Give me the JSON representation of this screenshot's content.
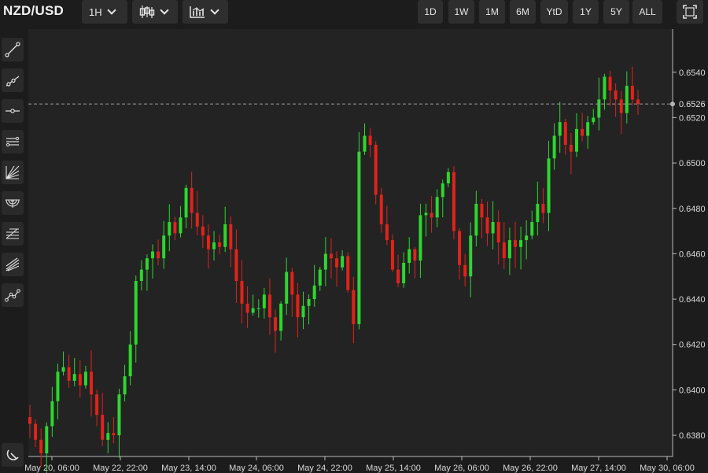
{
  "symbol": "NZD/USD",
  "interval": {
    "label": "1H"
  },
  "ranges": [
    "1D",
    "1W",
    "1M",
    "6M",
    "YtD",
    "1Y",
    "5Y",
    "ALL"
  ],
  "icons": {
    "chart_type": "candlestick-icon",
    "indicators": "bar-chart-icon",
    "fullscreen": "fullscreen-icon",
    "tools": [
      "trendline-icon",
      "ray-icon",
      "horizontal-line-icon",
      "channel-icon",
      "gann-fan-icon",
      "fib-arc-icon",
      "fib-retracement-icon",
      "pitchfork-icon",
      "path-icon",
      "magnet-icon"
    ]
  },
  "colors": {
    "up": "#2ed62e",
    "down": "#e0231a",
    "background": "#232323"
  },
  "chart_data": {
    "type": "candlestick",
    "title": "",
    "xlabel": "",
    "ylabel": "",
    "x_tick_labels": [
      "May 20, 06:00",
      "May 22, 22:00",
      "May 23, 14:00",
      "May 24, 06:00",
      "May 24, 22:00",
      "May 25, 14:00",
      "May 26, 06:00",
      "May 26, 22:00",
      "May 27, 14:00",
      "May 30, 06:00"
    ],
    "y_ticks": [
      0.638,
      0.64,
      0.642,
      0.644,
      0.646,
      0.648,
      0.65,
      0.652,
      0.654
    ],
    "y_tick_labels": [
      "0.6380",
      "0.6400",
      "0.6420",
      "0.6440",
      "0.6460",
      "0.6480",
      "0.6500",
      "0.6520",
      "0.6540"
    ],
    "ylim": [
      0.6371,
      0.6559
    ],
    "last_price": 0.6526,
    "last_price_label": "0.6526",
    "grid": false,
    "close_path": [
      0.6385,
      0.6378,
      0.6372,
      0.6384,
      0.6395,
      0.6408,
      0.641,
      0.6404,
      0.6407,
      0.6402,
      0.6408,
      0.6398,
      0.6389,
      0.6378,
      0.6381,
      0.638,
      0.6398,
      0.6406,
      0.642,
      0.6448,
      0.6453,
      0.6458,
      0.6461,
      0.6458,
      0.6468,
      0.6474,
      0.6469,
      0.6476,
      0.6489,
      0.6478,
      0.6472,
      0.6468,
      0.6462,
      0.6465,
      0.6463,
      0.6473,
      0.6462,
      0.6448,
      0.6438,
      0.6434,
      0.6436,
      0.6436,
      0.6442,
      0.6432,
      0.6426,
      0.6438,
      0.6452,
      0.6442,
      0.6432,
      0.6437,
      0.644,
      0.6446,
      0.6453,
      0.646,
      0.6458,
      0.6454,
      0.6459,
      0.6444,
      0.6429,
      0.6505,
      0.6512,
      0.6508,
      0.6486,
      0.6473,
      0.6466,
      0.6453,
      0.6447,
      0.6456,
      0.6462,
      0.6457,
      0.6477,
      0.6478,
      0.6476,
      0.6485,
      0.6491,
      0.6496,
      0.647,
      0.6455,
      0.645,
      0.6468,
      0.6482,
      0.6476,
      0.6469,
      0.6474,
      0.6465,
      0.6458,
      0.6466,
      0.6463,
      0.6466,
      0.6468,
      0.6474,
      0.6482,
      0.6478,
      0.6502,
      0.6512,
      0.6518,
      0.6508,
      0.6505,
      0.6515,
      0.6512,
      0.6518,
      0.652,
      0.6528,
      0.6538,
      0.6532,
      0.6528,
      0.6522,
      0.6534,
      0.6528,
      0.6526
    ]
  },
  "x_ticks": [
    "May 20, 06:00",
    "May 22, 22:00",
    "May 23, 14:00",
    "May 24, 06:00",
    "May 24, 22:00",
    "May 25, 14:00",
    "May 26, 06:00",
    "May 26, 22:00",
    "May 27, 14:00",
    "May 30, 06:00"
  ]
}
